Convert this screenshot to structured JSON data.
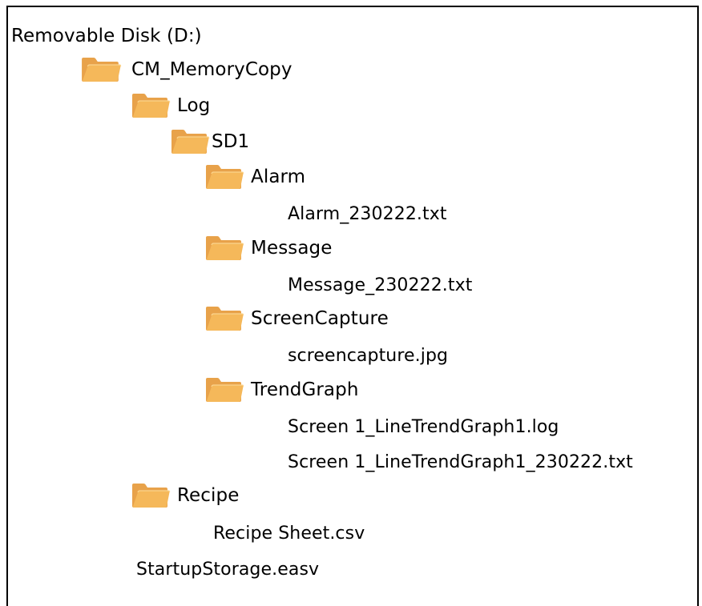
{
  "tree": {
    "root": "Removable Disk (D:)",
    "cm_memorycopy": "CM_MemoryCopy",
    "log": "Log",
    "sd1": "SD1",
    "alarm": "Alarm",
    "alarm_file": "Alarm_230222.txt",
    "message": "Message",
    "message_file": "Message_230222.txt",
    "screencapture": "ScreenCapture",
    "screencapture_file": "screencapture.jpg",
    "trendgraph": "TrendGraph",
    "trend_log_file": "Screen 1_LineTrendGraph1.log",
    "trend_txt_file": "Screen 1_LineTrendGraph1_230222.txt",
    "recipe": "Recipe",
    "recipe_file": "Recipe Sheet.csv",
    "startup_file": "StartupStorage.easv"
  },
  "icons": {
    "folder": "folder-icon"
  },
  "colors": {
    "folder_front": "#f5b85a",
    "folder_back": "#e8a24a",
    "border": "#000000"
  }
}
